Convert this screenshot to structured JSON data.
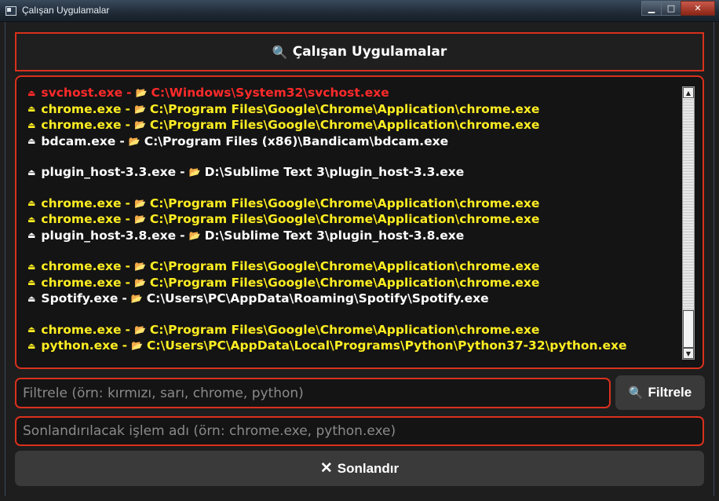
{
  "window": {
    "title": "Çalışan Uygulamalar",
    "minimize": "▁",
    "maximize": "□",
    "close": "✕"
  },
  "header": {
    "icon": "magnifier-icon",
    "icon_glyph": "🔍",
    "title": "Çalışan Uygulamalar"
  },
  "colors": {
    "accent_border": "#d9311d",
    "red": "#ff2a2a",
    "yellow": "#ffee22",
    "white": "#ffffff"
  },
  "process_list": [
    {
      "name": "svchost.exe",
      "path": "C:\\Windows\\System32\\svchost.exe",
      "color": "red"
    },
    {
      "name": "chrome.exe",
      "path": "C:\\Program Files\\Google\\Chrome\\Application\\chrome.exe",
      "color": "yellow"
    },
    {
      "name": "chrome.exe",
      "path": "C:\\Program Files\\Google\\Chrome\\Application\\chrome.exe",
      "color": "yellow"
    },
    {
      "name": "bdcam.exe",
      "path": "C:\\Program Files (x86)\\Bandicam\\bdcam.exe",
      "color": "white"
    },
    {
      "gap": true
    },
    {
      "name": "plugin_host-3.3.exe",
      "path": "D:\\Sublime Text 3\\plugin_host-3.3.exe",
      "color": "white"
    },
    {
      "gap": true
    },
    {
      "name": "chrome.exe",
      "path": "C:\\Program Files\\Google\\Chrome\\Application\\chrome.exe",
      "color": "yellow"
    },
    {
      "name": "chrome.exe",
      "path": "C:\\Program Files\\Google\\Chrome\\Application\\chrome.exe",
      "color": "yellow"
    },
    {
      "name": "plugin_host-3.8.exe",
      "path": "D:\\Sublime Text 3\\plugin_host-3.8.exe",
      "color": "white"
    },
    {
      "gap": true
    },
    {
      "name": "chrome.exe",
      "path": "C:\\Program Files\\Google\\Chrome\\Application\\chrome.exe",
      "color": "yellow"
    },
    {
      "name": "chrome.exe",
      "path": "C:\\Program Files\\Google\\Chrome\\Application\\chrome.exe",
      "color": "yellow"
    },
    {
      "name": "Spotify.exe",
      "path": "C:\\Users\\PC\\AppData\\Roaming\\Spotify\\Spotify.exe",
      "color": "white"
    },
    {
      "gap": true
    },
    {
      "name": "chrome.exe",
      "path": "C:\\Program Files\\Google\\Chrome\\Application\\chrome.exe",
      "color": "yellow"
    },
    {
      "name": "python.exe",
      "path": "C:\\Users\\PC\\AppData\\Local\\Programs\\Python\\Python37-32\\python.exe",
      "color": "yellow"
    }
  ],
  "list_glyphs": {
    "bullet": "⏏",
    "separator": "-",
    "folder": "📂"
  },
  "filter": {
    "placeholder": "Filtrele (örn: kırmızı, sarı, chrome, python)",
    "value": "",
    "button_label": "Filtrele",
    "button_icon_glyph": "🔍"
  },
  "terminate": {
    "placeholder": "Sonlandırılacak işlem adı (örn: chrome.exe, python.exe)",
    "value": "",
    "button_label": "Sonlandır",
    "button_icon_glyph": "✕"
  }
}
